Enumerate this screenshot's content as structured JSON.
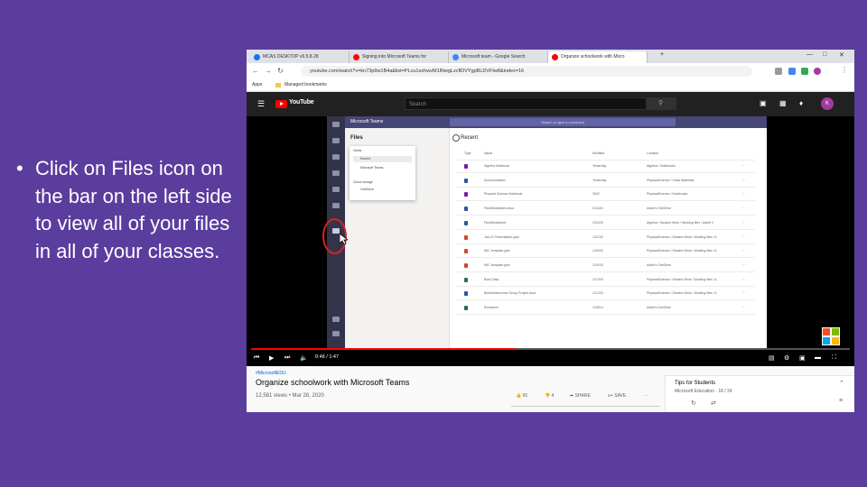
{
  "slide": {
    "bullet_char": "•",
    "bullet_text": "Click on Files icon on the bar on the left side to view all of your files in all of your classes."
  },
  "browser": {
    "tabs": [
      {
        "label": "MCAS DESKTOP v6.5.8.28",
        "favicon_color": "#1a73e8"
      },
      {
        "label": "Signing into Microsoft Teams for",
        "favicon_color": "#ff0000"
      },
      {
        "label": "Microsoft team - Google Search",
        "favicon_color": "#4285f4"
      },
      {
        "label": "Organize schoolwork with Micro",
        "favicon_color": "#ff0000"
      }
    ],
    "new_tab": "+",
    "url": "youtube.com/watch?v=kn73p9w1B4a&list=PLcu1ezhwvM1lNwgLzcflDVYgpBLDVFtw8&index=16",
    "bookmarks": [
      "Apps",
      "Managed bookmarks"
    ]
  },
  "youtube": {
    "logo_text": "YouTube",
    "search_placeholder": "Search",
    "avatar_letter": "K",
    "player": {
      "current_time": "0:48",
      "duration": "1:47",
      "progress": 0.44
    },
    "video": {
      "hashtag": "#MicrosoftEDU",
      "title": "Organize schoolwork with Microsoft Teams",
      "meta": "12,581 views • Mar 28, 2020",
      "likes": "65",
      "dislikes": "4",
      "share": "SHARE",
      "save": "SAVE"
    },
    "playlist": {
      "title": "Tips for Students",
      "subtitle": "Microsoft Education",
      "position": "18 / 24"
    }
  },
  "teams": {
    "app_title": "Microsoft Teams",
    "search_placeholder": "Search or type a command",
    "panel_title": "Files",
    "popup": [
      "Views",
      "Recent",
      "Microsoft Teams",
      "Cloud storage",
      "OneDrive"
    ],
    "main_title": "Recent",
    "columns": [
      "Type",
      "Name",
      "Modified",
      "Location"
    ],
    "files": [
      {
        "name": "Algebra Notebook",
        "modified": "Yesterday",
        "location": "Algebra / Notebooks",
        "color": "#7719aa"
      },
      {
        "name": "Documentation",
        "modified": "Yesterday",
        "location": "PhysicalScience / Class Materials",
        "color": "#2b579a"
      },
      {
        "name": "Physical Science Notebook",
        "modified": "3/5/2",
        "location": "PhysicalScience / Notebooks",
        "color": "#7719aa"
      },
      {
        "name": "FieldWorkNotes.docx",
        "modified": "2/24/20",
        "location": "Adele's OneDrive",
        "color": "#2b579a"
      },
      {
        "name": "FieldWorksheet",
        "modified": "2/24/20",
        "location": "Algebra / Student Work / Working files / Adele V",
        "color": "#2b579a"
      },
      {
        "name": "Jan 21 Presentation.pptx",
        "modified": "1/21/20",
        "location": "PhysicalScience / Student Work / Working files / A",
        "color": "#d24726"
      },
      {
        "name": "WIC template.pptx",
        "modified": "1/20/20",
        "location": "PhysicalScience / Student Work / Working files / A",
        "color": "#d24726"
      },
      {
        "name": "WIC template.pptx",
        "modified": "1/20/20",
        "location": "Adele's OneDrive",
        "color": "#d24726"
      },
      {
        "name": "Book Data",
        "modified": "1/12/20",
        "location": "PhysicalScience / Student Work / Working files / A",
        "color": "#217346"
      },
      {
        "name": "Bioluminescence Group Project.docx",
        "modified": "1/12/20",
        "location": "PhysicalScience / Student Work / Working files / A",
        "color": "#2b579a"
      },
      {
        "name": "Emissions",
        "modified": "12/5/19",
        "location": "Adele's OneDrive",
        "color": "#217346"
      }
    ]
  },
  "colors": {
    "slide_background": "#5b3d9e",
    "annotation_circle": "#e02020",
    "youtube_red": "#ff0000"
  }
}
